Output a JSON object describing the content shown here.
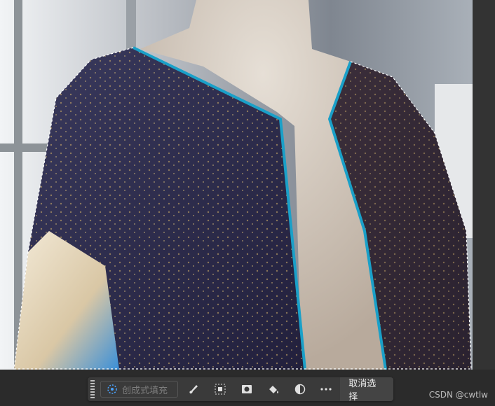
{
  "context_bar": {
    "generative_fill_label": "创成式填充",
    "deselect_label": "取消选择",
    "tools": [
      "brush-icon",
      "invert-selection-icon",
      "mask-icon",
      "fill-bucket-icon",
      "adjustment-icon",
      "more-icon"
    ]
  },
  "watermark": "CSDN @cwtlw",
  "colors": {
    "selection_edge": "#1aa0c8",
    "garment": "#2c2b4a",
    "mannequin": "#d9cfc4",
    "toolbar": "#3a3a3a"
  }
}
